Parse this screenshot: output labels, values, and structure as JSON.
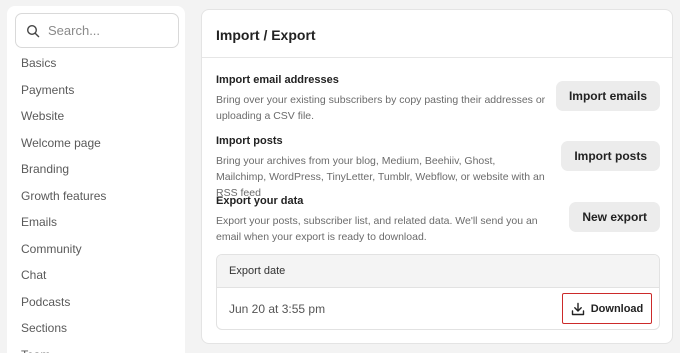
{
  "sidebar": {
    "search_placeholder": "Search...",
    "items": [
      {
        "label": "Basics"
      },
      {
        "label": "Payments"
      },
      {
        "label": "Website"
      },
      {
        "label": "Welcome page"
      },
      {
        "label": "Branding"
      },
      {
        "label": "Growth features"
      },
      {
        "label": "Emails"
      },
      {
        "label": "Community"
      },
      {
        "label": "Chat"
      },
      {
        "label": "Podcasts"
      },
      {
        "label": "Sections"
      },
      {
        "label": "Team"
      }
    ]
  },
  "main": {
    "title": "Import / Export",
    "sections": [
      {
        "heading": "Import email addresses",
        "description": "Bring over your existing subscribers by copy pasting their addresses or uploading a CSV file.",
        "button": "Import emails"
      },
      {
        "heading": "Import posts",
        "description": "Bring your archives from your blog, Medium, Beehiiv, Ghost, Mailchimp, WordPress, TinyLetter, Tumblr, Webflow, or website with an RSS feed",
        "button": "Import posts"
      },
      {
        "heading": "Export your data",
        "description": "Export your posts, subscriber list, and related data. We'll send you an email when your export is ready to download.",
        "button": "New export"
      }
    ],
    "export_table": {
      "header": "Export date",
      "rows": [
        {
          "date": "Jun 20 at 3:55 pm",
          "action": "Download"
        }
      ]
    }
  },
  "icons": {
    "search": "search-icon",
    "download": "download-icon"
  },
  "colors": {
    "highlight_border": "#cc2a2a",
    "button_bg": "#ececec"
  }
}
